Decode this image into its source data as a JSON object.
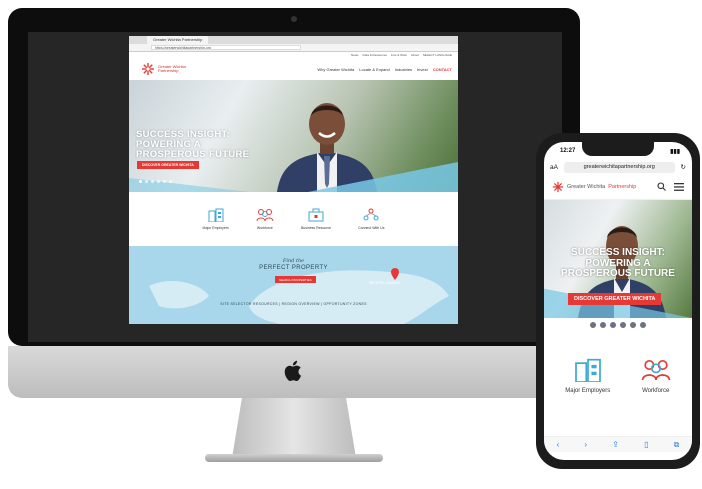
{
  "desktop": {
    "browser": {
      "tab_title": "Greater Wichita Partnership",
      "url": "https://greaterwichitapartnership.org"
    },
    "util_nav": [
      "News",
      "Data & Resources",
      "Live & Work",
      "About",
      "SELECT LANGUAGE"
    ],
    "logo": {
      "line1": "Greater Wichita",
      "line2": "Partnership"
    },
    "main_nav": [
      "Why Greater Wichita",
      "Locate & Expand",
      "Industries",
      "Invest",
      "CONTACT"
    ],
    "hero": {
      "title_line1": "SUCCESS INSIGHT:",
      "title_line2": "POWERING A",
      "title_line3": "PROSPEROUS FUTURE",
      "button": "DISCOVER GREATER WICHITA"
    },
    "icons": [
      {
        "label": "Major Employers",
        "icon": "office-building-icon"
      },
      {
        "label": "Workforce",
        "icon": "people-icon"
      },
      {
        "label": "Business Resource",
        "icon": "briefcase-icon"
      },
      {
        "label": "Connect With Us",
        "icon": "connect-people-icon"
      }
    ],
    "map": {
      "kicker": "Find the",
      "title": "PERFECT PROPERTY",
      "button": "SEARCH PROPERTIES",
      "pin_label": "WICHITA, KANSAS",
      "links": "SITE SELECTOR RESOURCES  |  REGION OVERVIEW  |  OPPORTUNITY ZONES"
    }
  },
  "phone": {
    "time": "12:27",
    "url_aa": "aA",
    "url": "greaterwichitapartnership.org",
    "logo_plain": "Greater Wichita ",
    "logo_accent": "Partnership",
    "hero": {
      "title_line1": "SUCCESS INSIGHT:",
      "title_line2": "POWERING A",
      "title_line3": "PROSPEROUS FUTURE",
      "button": "DISCOVER GREATER WICHITA"
    },
    "icons": [
      {
        "label": "Major Employers",
        "icon": "office-building-icon"
      },
      {
        "label": "Workforce",
        "icon": "people-icon"
      }
    ]
  },
  "colors": {
    "accent": "#e53935",
    "sky": "#a8d6ea",
    "icon_blue": "#3fa9d6"
  }
}
